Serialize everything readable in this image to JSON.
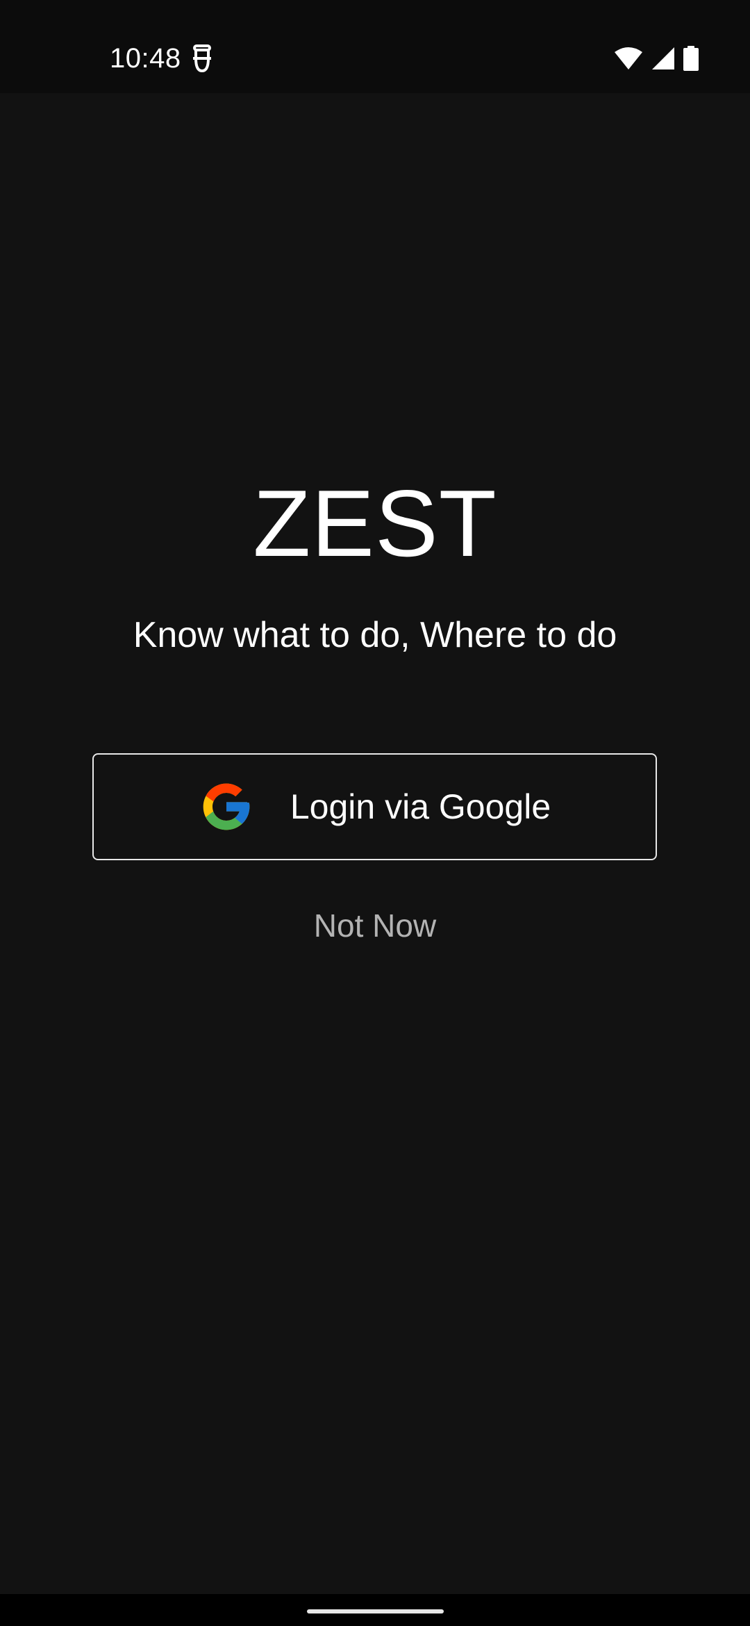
{
  "status_bar": {
    "time": "10:48",
    "icons": [
      "app-notification-icon",
      "wifi-icon",
      "cellular-signal-icon",
      "battery-icon"
    ]
  },
  "app": {
    "title": "ZEST",
    "tagline": "Know what to do, Where to do"
  },
  "actions": {
    "login_label": "Login via Google",
    "login_icon": "google-icon",
    "skip_label": "Not Now"
  },
  "colors": {
    "background": "#121212",
    "status_bar": "#0c0c0c",
    "text": "#ffffff",
    "secondary_text": "#b3b3b3",
    "google_blue": "#4285F4",
    "google_red": "#EA4335",
    "google_yellow": "#FBBC05",
    "google_green": "#34A853"
  }
}
